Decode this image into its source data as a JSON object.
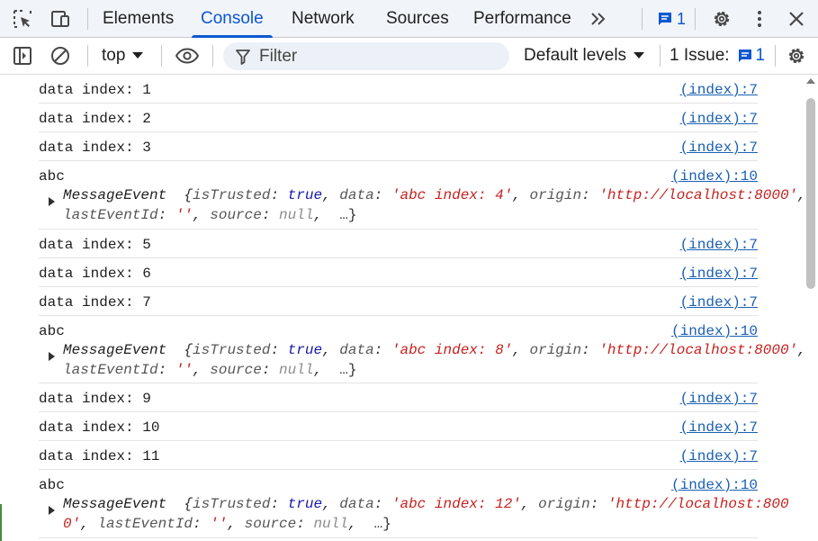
{
  "tabs": [
    {
      "label": "Elements",
      "active": false
    },
    {
      "label": "Console",
      "active": true
    },
    {
      "label": "Network",
      "active": false
    },
    {
      "label": "Sources",
      "active": false
    },
    {
      "label": "Performance",
      "active": false
    }
  ],
  "header": {
    "messages_badge_count": "1",
    "icons": [
      "inspect-element-icon",
      "device-toolbar-icon",
      "more-tabs-icon",
      "messages-icon",
      "settings-gear-icon",
      "kebab-menu-icon",
      "close-icon"
    ]
  },
  "toolbar": {
    "context": "top",
    "filter_placeholder": "Filter",
    "levels": "Default levels",
    "issues_label": "1 Issue:",
    "issues_count": "1"
  },
  "messages": [
    {
      "type": "simple",
      "text": "data index: 1",
      "source": "(index):7"
    },
    {
      "type": "simple",
      "text": "data index: 2",
      "source": "(index):7"
    },
    {
      "type": "simple",
      "text": "data index: 3",
      "source": "(index):7"
    },
    {
      "type": "object",
      "text": "abc",
      "source": "(index):10",
      "obj": {
        "class": "MessageEvent",
        "isTrusted": "true",
        "data": "'abc index: 4'",
        "origin_part1": "'http://localhost:8000'",
        "origin_part2": "",
        "lastEventId": "''",
        "source": "null",
        "ellipsis": "…}"
      }
    },
    {
      "type": "simple",
      "text": "data index: 5",
      "source": "(index):7"
    },
    {
      "type": "simple",
      "text": "data index: 6",
      "source": "(index):7"
    },
    {
      "type": "simple",
      "text": "data index: 7",
      "source": "(index):7"
    },
    {
      "type": "object",
      "text": "abc",
      "source": "(index):10",
      "obj": {
        "class": "MessageEvent",
        "isTrusted": "true",
        "data": "'abc index: 8'",
        "origin_part1": "'http://localhost:8000'",
        "origin_part2": "",
        "lastEventId": "''",
        "source": "null",
        "ellipsis": "…}"
      }
    },
    {
      "type": "simple",
      "text": "data index: 9",
      "source": "(index):7"
    },
    {
      "type": "simple",
      "text": "data index: 10",
      "source": "(index):7"
    },
    {
      "type": "simple",
      "text": "data index: 11",
      "source": "(index):7"
    },
    {
      "type": "object",
      "text": "abc",
      "source": "(index):10",
      "obj": {
        "class": "MessageEvent",
        "isTrusted": "true",
        "data": "'abc index: 12'",
        "origin_part1": "'http://localhost:800",
        "origin_part2": "0'",
        "lastEventId": "''",
        "source": "null",
        "ellipsis": "…}"
      }
    }
  ]
}
